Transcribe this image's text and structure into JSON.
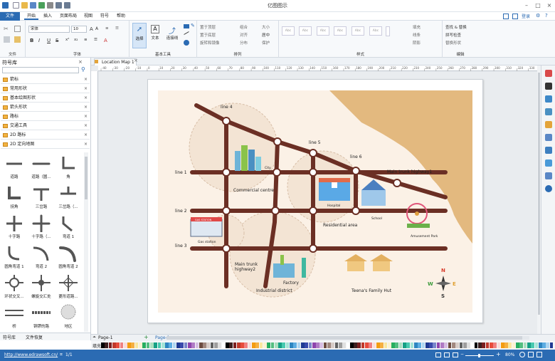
{
  "window": {
    "title": "亿图图示"
  },
  "quick_access": [
    "file-new-icon",
    "open-folder-icon",
    "save-icon",
    "undo-icon",
    "redo-icon",
    "print-icon",
    "export-icon",
    "quick-access-more-icon"
  ],
  "menu": {
    "items": [
      "文件",
      "开始",
      "插入",
      "页面布局",
      "视图",
      "符号",
      "帮助"
    ],
    "active": "开始"
  },
  "account": {
    "login": "登录"
  },
  "ribbon": {
    "groups": [
      {
        "label": "文件"
      },
      {
        "label": "字体"
      },
      {
        "label": "基本工具"
      },
      {
        "label": "排列"
      },
      {
        "label": "样式"
      },
      {
        "label": "编辑"
      }
    ],
    "font_name": "宋体",
    "font_size": "10",
    "tools": {
      "select": "选择",
      "text": "文本",
      "connector": "连接线"
    },
    "arrange": {
      "bring_front": "置于顶层",
      "send_back": "置于底层",
      "rotate_flip": "旋转和镜像",
      "group": "组合",
      "align": "对齐",
      "distribute": "分布",
      "size": "大小",
      "center": "居中",
      "protect": "保护"
    },
    "style_boxes": [
      "Abc",
      "Abc",
      "Abc",
      "Abc",
      "Abc",
      "Abc"
    ],
    "style_side": {
      "fill": "填充",
      "line": "线条",
      "shadow": "阴影"
    },
    "edit": {
      "find_replace": "查找 & 替换",
      "spell_check": "拼写检查",
      "change_shape": "替换形状"
    }
  },
  "doc_tab": {
    "label": "Location Map 1"
  },
  "library": {
    "title": "符号库",
    "items": [
      "箭标",
      "常用形状",
      "基本绘图形状",
      "箭头形状",
      "路标",
      "交通工具",
      "2D 路标",
      "2D 定向地图"
    ],
    "shapes": [
      "道路",
      "道路（圆...",
      "角",
      "拐角",
      "三岔路",
      "三岔路（...",
      "十字路",
      "十字路（...",
      "弯道 1",
      "圆角弯道 1",
      "弯道 2",
      "圆角弯道 2",
      "环状交叉...",
      "螺旋交汇处",
      "菱形道路...",
      "桥",
      "铜锣的路",
      "地区"
    ],
    "tabs": [
      "符号库",
      "文件恢复"
    ]
  },
  "ruler": {
    "h": [
      "-40",
      "-30",
      "-20",
      "-10",
      "0",
      "10",
      "20",
      "30",
      "40",
      "50",
      "60",
      "70",
      "80",
      "90",
      "100",
      "110",
      "120",
      "130",
      "140",
      "150",
      "160",
      "170",
      "180",
      "190",
      "200",
      "210",
      "220",
      "230",
      "240",
      "250",
      "260",
      "270",
      "280",
      "290",
      "300",
      "310",
      "320",
      "330"
    ]
  },
  "map": {
    "labels": {
      "line4": "line 4",
      "line5": "line 5",
      "line6": "line 6",
      "line1": "line 1",
      "line2": "line 2",
      "line3": "line 3",
      "trunk1": "Main trunk highway1",
      "trunk2a": "Main trunk",
      "trunk2b": "highway2",
      "city": "City",
      "commercial": "Commercial centre",
      "hospital": "Hospital",
      "school": "School",
      "residential": "Residential area",
      "amusement": "Amusement Park",
      "gas_sign": "GAS STATION",
      "gas": "Gas station",
      "factory": "Factory",
      "industrial": "Industrial district",
      "family": "Teena's Family Hut",
      "compass_n": "N",
      "compass_s": "S",
      "compass_e": "E",
      "compass_w": "W"
    },
    "colors": {
      "road": "#6b2f24",
      "sand": "#e3b97f",
      "paper": "#fbf1e6",
      "zone": "#f3e4d4"
    }
  },
  "pagebar": {
    "page_tab": "Page-1",
    "page_tab_active": "Page-1"
  },
  "palette": {
    "label": "填充"
  },
  "status": {
    "url": "http://www.edrawsoft.cn/",
    "page": "1/1",
    "zoom": "80%"
  }
}
